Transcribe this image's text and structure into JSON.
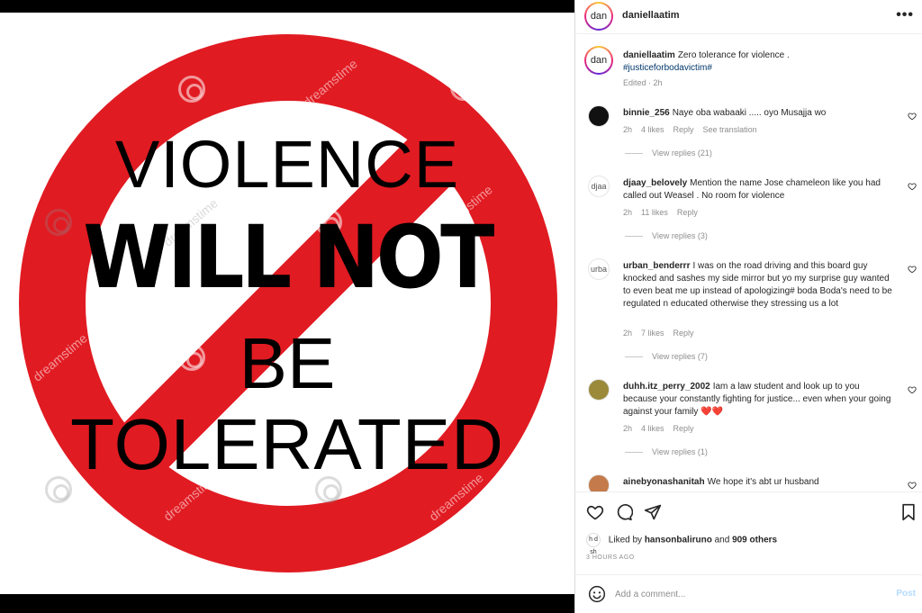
{
  "sign": {
    "line1": "VIOLENCE",
    "line2": "WILL NOT",
    "line3": "BE",
    "line4": "TOLERATED",
    "watermark": "dreamstime",
    "ring_color": "#e11b22"
  },
  "post": {
    "username": "daniellaatim",
    "avatar_text": "dan",
    "more_icon": "more-horizontal-icon"
  },
  "caption": {
    "username": "daniellaatim",
    "text": "Zero tolerance for violence .",
    "hashtag": "#justiceforbodavictim#",
    "meta": "Edited · 2h"
  },
  "comments": [
    {
      "username": "binnie_256",
      "text": "Naye oba wabaaki ..... oyo Musajja wo",
      "time": "2h",
      "likes": "4 likes",
      "reply": "Reply",
      "extra": "See translation",
      "view_replies": "View replies (21)",
      "avatar_text": ""
    },
    {
      "username": "djaay_belovely",
      "text": "Mention the name Jose chameleon like you had called out Weasel . No room for violence",
      "time": "2h",
      "likes": "11 likes",
      "reply": "Reply",
      "view_replies": "View replies (3)",
      "avatar_text": "djaa"
    },
    {
      "username": "urban_benderrr",
      "text": "I was on the road driving and this board guy knocked and sashes my side mirror but yo my surprise guy wanted to even beat me up instead of apologizing# boda Boda's need to be regulated n educated otherwise they stressing us a lot",
      "time": "2h",
      "likes": "7 likes",
      "reply": "Reply",
      "view_replies": "View replies (7)",
      "avatar_text": "urba"
    },
    {
      "username": "duhh.itz_perry_2002",
      "text": "Iam a law student and look up to you because your constantly fighting for justice... even when your going against your family",
      "emoji": "❤️❤️",
      "time": "2h",
      "likes": "4 likes",
      "reply": "Reply",
      "view_replies": "View replies (1)",
      "avatar_text": ""
    },
    {
      "username": "ainebyonashanitah",
      "text": "We hope it's abt ur husband",
      "avatar_text": ""
    }
  ],
  "likes": {
    "avatar_text": "h d sh",
    "prefix": "Liked by",
    "user": "hansonbaliruno",
    "middle": "and",
    "others": "909 others"
  },
  "timestamp": "3 HOURS AGO",
  "comment_box": {
    "placeholder": "Add a comment...",
    "post_label": "Post"
  },
  "colors": {
    "hashtag": "#00376b",
    "heart": "#ed4956",
    "post_button": "#b3dbff"
  }
}
